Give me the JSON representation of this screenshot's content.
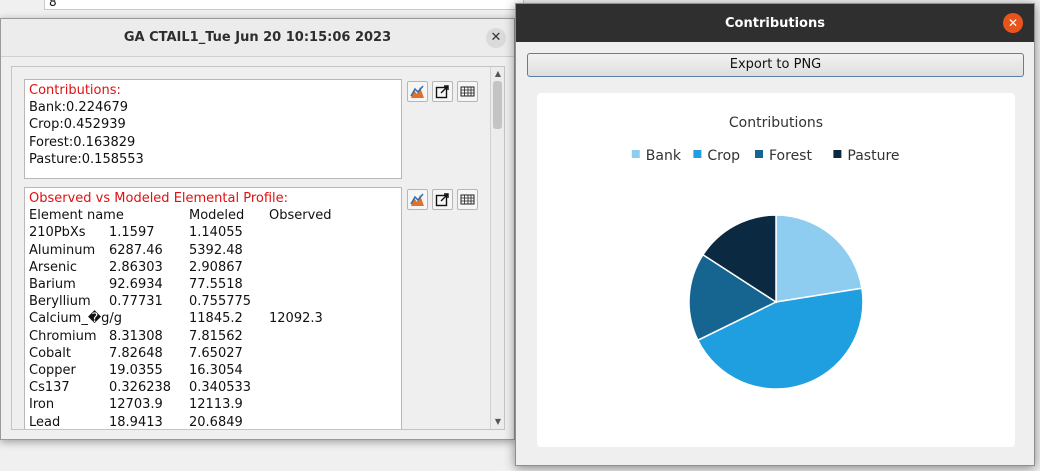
{
  "background": {
    "field_value": "8"
  },
  "result_window": {
    "title": "GA CTAIL1_Tue Jun 20 10:15:06 2023",
    "close_label": "✕",
    "contributions": {
      "heading": "Contributions:",
      "lines": [
        "Bank:0.224679",
        "Crop:0.452939",
        "Forest:0.163829",
        "Pasture:0.158553"
      ]
    },
    "profile": {
      "heading": "Observed vs Modeled Elemental Profile:",
      "columns": [
        "Element name",
        "",
        "Modeled",
        "Observed"
      ],
      "rows": [
        [
          "210PbXs",
          "1.1597",
          "1.14055",
          ""
        ],
        [
          "Aluminum",
          "6287.46",
          "5392.48",
          ""
        ],
        [
          "Arsenic",
          "2.86303",
          "2.90867",
          ""
        ],
        [
          "Barium",
          "92.6934",
          "77.5518",
          ""
        ],
        [
          "Beryllium",
          "0.77731",
          "0.755775",
          ""
        ],
        [
          "Calcium_�g/g",
          "",
          "11845.2",
          "12092.3"
        ],
        [
          "Chromium",
          "8.31308",
          "7.81562",
          ""
        ],
        [
          "Cobalt",
          "7.82648",
          "7.65027",
          ""
        ],
        [
          "Copper",
          "19.0355",
          "16.3054",
          ""
        ],
        [
          "Cs137",
          "0.326238",
          "0.340533",
          ""
        ],
        [
          "Iron",
          "12703.9",
          "12113.9",
          ""
        ],
        [
          "Lead",
          "18.9413",
          "20.6849",
          ""
        ]
      ]
    },
    "tools": [
      "chart-icon",
      "export-icon",
      "table-icon"
    ]
  },
  "chart_window": {
    "title": "Contributions",
    "close_label": "✕",
    "export_label": "Export to PNG",
    "chart_data": {
      "type": "pie",
      "title": "Contributions",
      "legend_position": "top",
      "categories": [
        "Bank",
        "Crop",
        "Forest",
        "Pasture"
      ],
      "values": [
        0.224679,
        0.452939,
        0.163829,
        0.158553
      ],
      "colors": [
        "#8fcdf0",
        "#1f9fdf",
        "#166591",
        "#0b2a42"
      ]
    }
  }
}
